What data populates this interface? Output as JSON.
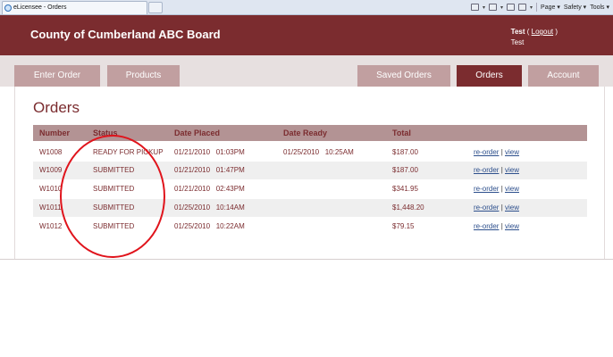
{
  "browser": {
    "tab_title": "eLicensee - Orders",
    "tools": {
      "page": "Page",
      "safety": "Safety",
      "tools": "Tools"
    }
  },
  "header": {
    "title": "County of Cumberland ABC Board",
    "user": "Test",
    "logout_label": "Logout",
    "account_name": "Test"
  },
  "nav": {
    "tabs": [
      {
        "label": "Enter Order",
        "active": false
      },
      {
        "label": "Products",
        "active": false
      },
      {
        "label": "Saved Orders",
        "active": false
      },
      {
        "label": "Orders",
        "active": true
      },
      {
        "label": "Account",
        "active": false
      }
    ]
  },
  "main": {
    "title": "Orders",
    "columns": [
      "Number",
      "Status",
      "Date Placed",
      "Date Ready",
      "Total"
    ],
    "rows": [
      {
        "number": "W1008",
        "status": "READY FOR PICKUP",
        "date_placed": "01/21/2010   01:03PM",
        "date_ready": "01/25/2010   10:25AM",
        "total": "$187.00",
        "reorder": "re-order",
        "view": "view"
      },
      {
        "number": "W1009",
        "status": "SUBMITTED",
        "date_placed": "01/21/2010   01:47PM",
        "date_ready": "",
        "total": "$187.00",
        "reorder": "re-order",
        "view": "view"
      },
      {
        "number": "W1010",
        "status": "SUBMITTED",
        "date_placed": "01/21/2010   02:43PM",
        "date_ready": "",
        "total": "$341.95",
        "reorder": "re-order",
        "view": "view"
      },
      {
        "number": "W1011",
        "status": "SUBMITTED",
        "date_placed": "01/25/2010   10:14AM",
        "date_ready": "",
        "total": "$1,448.20",
        "reorder": "re-order",
        "view": "view"
      },
      {
        "number": "W1012",
        "status": "SUBMITTED",
        "date_placed": "01/25/2010   10:22AM",
        "date_ready": "",
        "total": "$79.15",
        "reorder": "re-order",
        "view": "view"
      }
    ]
  },
  "colors": {
    "brand": "#7b2c2f",
    "nav_tab": "#c19fa0",
    "table_header": "#b39394",
    "link": "#2d4f8c",
    "annotation": "#e0141c"
  }
}
